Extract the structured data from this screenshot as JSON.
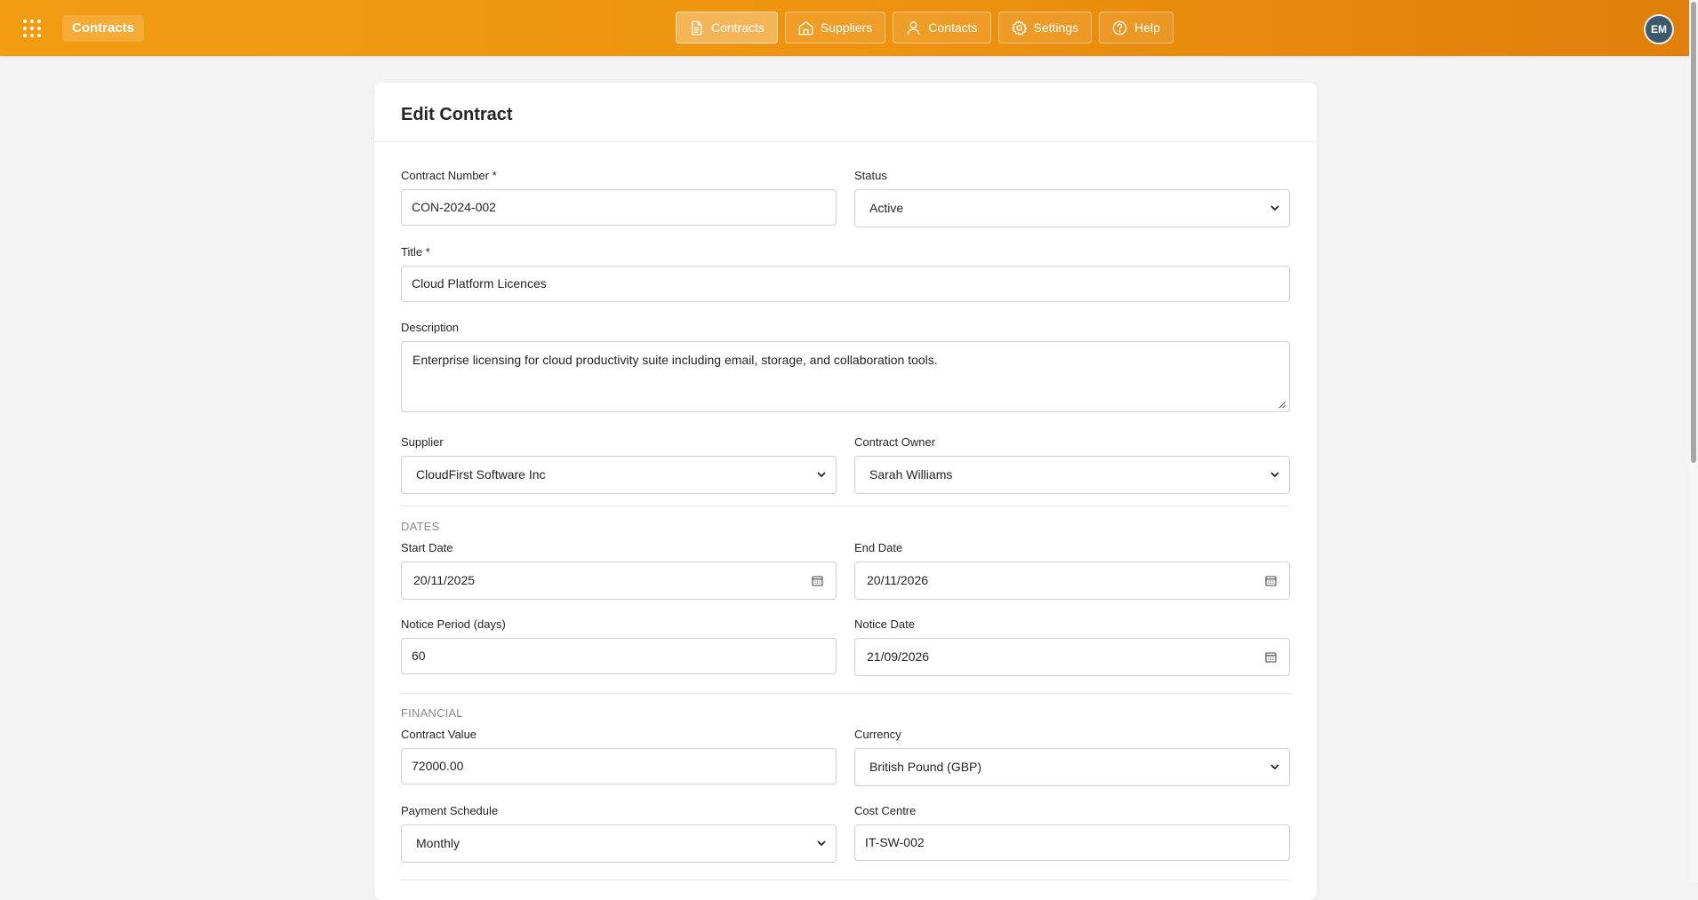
{
  "app": {
    "name": "Contracts"
  },
  "nav": [
    {
      "label": "Contracts",
      "icon": "document-icon",
      "active": true
    },
    {
      "label": "Suppliers",
      "icon": "building-icon",
      "active": false
    },
    {
      "label": "Contacts",
      "icon": "person-icon",
      "active": false
    },
    {
      "label": "Settings",
      "icon": "gear-icon",
      "active": false
    },
    {
      "label": "Help",
      "icon": "question-icon",
      "active": false
    }
  ],
  "user": {
    "initials": "EM"
  },
  "form": {
    "title": "Edit Contract",
    "contract_number": {
      "label": "Contract Number *",
      "value": "CON-2024-002"
    },
    "status": {
      "label": "Status",
      "value": "Active"
    },
    "title_field": {
      "label": "Title *",
      "value": "Cloud Platform Licences"
    },
    "description": {
      "label": "Description",
      "value": "Enterprise licensing for cloud productivity suite including email, storage, and collaboration tools."
    },
    "supplier": {
      "label": "Supplier",
      "value": "CloudFirst Software Inc"
    },
    "contract_owner": {
      "label": "Contract Owner",
      "value": "Sarah Williams"
    },
    "dates_section": "DATES",
    "start_date": {
      "label": "Start Date",
      "value": "20/11/2025"
    },
    "end_date": {
      "label": "End Date",
      "value": "20/11/2026"
    },
    "notice_period": {
      "label": "Notice Period (days)",
      "value": "60"
    },
    "notice_date": {
      "label": "Notice Date",
      "value": "21/09/2026"
    },
    "financial_section": "FINANCIAL",
    "contract_value": {
      "label": "Contract Value",
      "value": "72000.00"
    },
    "currency": {
      "label": "Currency",
      "value": "British Pound (GBP)"
    },
    "payment_schedule": {
      "label": "Payment Schedule",
      "value": "Monthly"
    },
    "cost_centre": {
      "label": "Cost Centre",
      "value": "IT-SW-002"
    }
  },
  "colors": {
    "brand": "#f39c12",
    "brand_dark": "#e07f0b",
    "avatar": "#3d5a6c"
  }
}
